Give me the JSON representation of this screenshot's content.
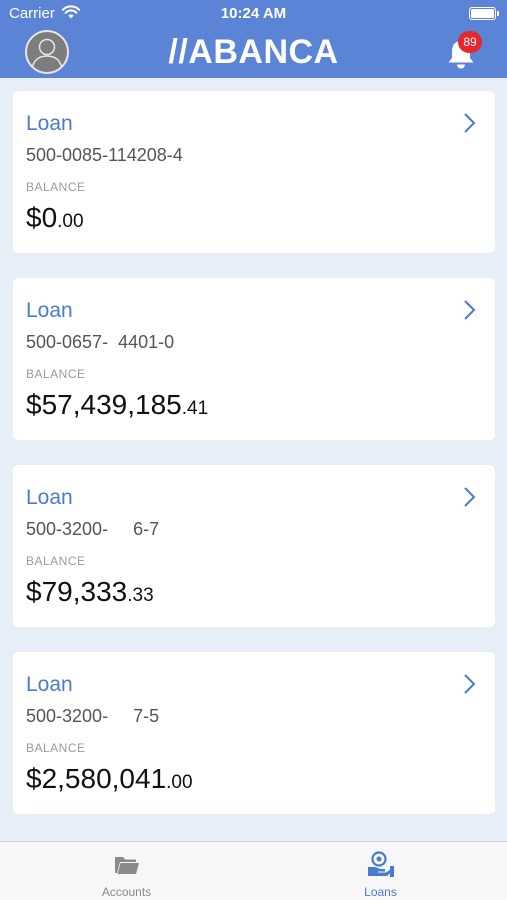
{
  "status_bar": {
    "carrier": "Carrier",
    "time": "10:24 AM"
  },
  "header": {
    "logo": "//ABANCA",
    "notification_count": "89"
  },
  "loans": [
    {
      "title": "Loan",
      "number": "500-0085-114208-4",
      "balance_label": "BALANCE",
      "amount_main": "$0",
      "amount_cents": ".00"
    },
    {
      "title": "Loan",
      "number": "500-0657-  4401-0",
      "balance_label": "BALANCE",
      "amount_main": "$57,439,185",
      "amount_cents": ".41"
    },
    {
      "title": "Loan",
      "number": "500-3200-     6-7",
      "balance_label": "BALANCE",
      "amount_main": "$79,333",
      "amount_cents": ".33"
    },
    {
      "title": "Loan",
      "number": "500-3200-     7-5",
      "balance_label": "BALANCE",
      "amount_main": "$2,580,041",
      "amount_cents": ".00"
    }
  ],
  "tabbar": {
    "tabs": [
      {
        "label": "Accounts",
        "icon": "folder-icon",
        "active": false
      },
      {
        "label": "Loans",
        "icon": "loan-hand-icon",
        "active": true
      }
    ]
  },
  "colors": {
    "header": "#5b84d6",
    "accent": "#4a7bd0",
    "badge": "#e8262b",
    "background": "#e8eef8"
  }
}
